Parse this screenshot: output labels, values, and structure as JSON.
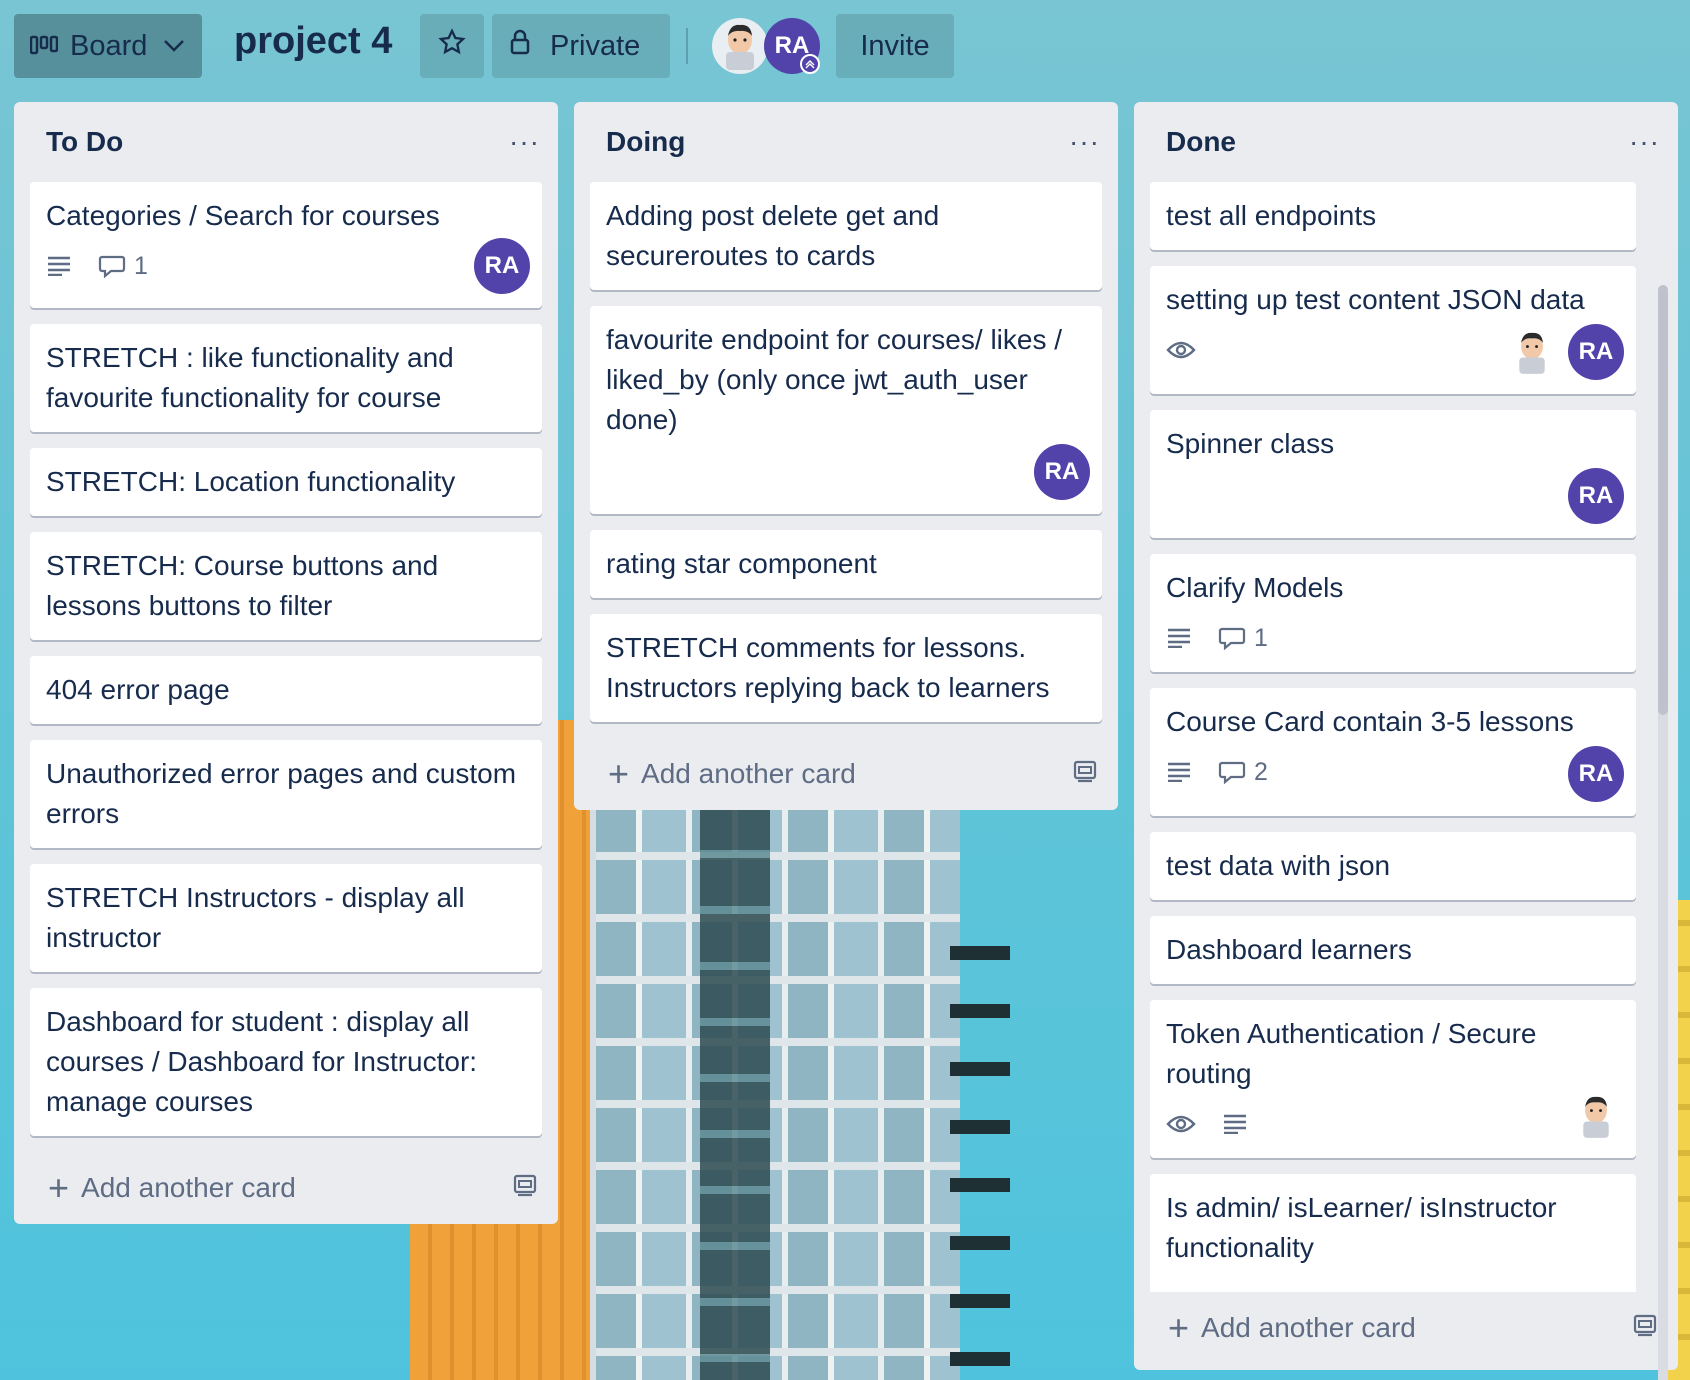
{
  "header": {
    "board_label": "Board",
    "board_title": "project 4",
    "private_label": "Private",
    "invite_label": "Invite",
    "member_initials": "RA"
  },
  "lists": [
    {
      "title": "To Do",
      "add_label": "Add another card",
      "cards": [
        {
          "text": "Categories / Search for courses",
          "comments": "1",
          "member": "RA"
        },
        {
          "text": "STRETCH : like functionality and favourite functionality for course"
        },
        {
          "text": "STRETCH: Location functionality"
        },
        {
          "text": "STRETCH: Course buttons and lessons buttons to filter"
        },
        {
          "text": "404 error page"
        },
        {
          "text": "Unauthorized error pages and custom errors"
        },
        {
          "text": "STRETCH Instructors - display all instructor"
        },
        {
          "text": "Dashboard for student : display all courses / Dashboard for Instructor: manage courses"
        }
      ]
    },
    {
      "title": "Doing",
      "add_label": "Add another card",
      "cards": [
        {
          "text": "Adding post delete get and secureroutes to cards"
        },
        {
          "text": "favourite endpoint for courses/ likes / liked_by (only once jwt_auth_user done)",
          "member": "RA"
        },
        {
          "text": "rating star component"
        },
        {
          "text": "STRETCH comments for lessons. Instructors replying back to learners"
        }
      ]
    },
    {
      "title": "Done",
      "add_label": "Add another card",
      "cards": [
        {
          "text": "test all endpoints"
        },
        {
          "text": "setting up test content JSON data",
          "member": "RA"
        },
        {
          "text": "Spinner class",
          "member": "RA"
        },
        {
          "text": "Clarify Models",
          "comments": "1"
        },
        {
          "text": "Course Card contain 3-5 lessons",
          "comments": "2",
          "member": "RA"
        },
        {
          "text": "test data with json"
        },
        {
          "text": "Dashboard learners"
        },
        {
          "text": "Token Authentication / Secure routing"
        },
        {
          "text": "Is admin/ isLearner/ isInstructor functionality"
        }
      ]
    }
  ],
  "colors": {
    "member_avatar": "#5243aa",
    "list_bg": "#ebecf0",
    "text": "#172b4d"
  }
}
